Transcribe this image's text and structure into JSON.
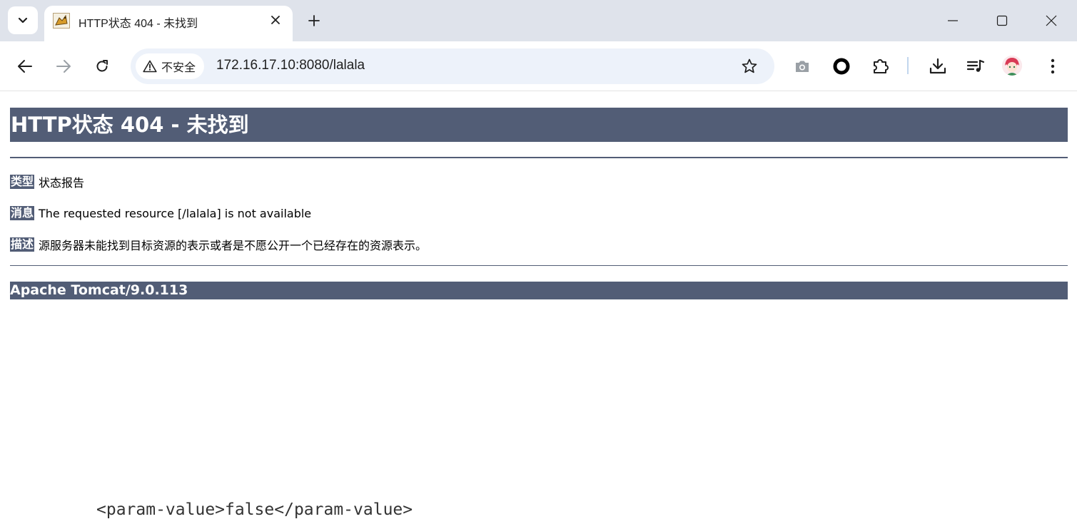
{
  "browser": {
    "tab": {
      "title": "HTTP状态 404 - 未找到"
    },
    "address_bar": {
      "security_label": "不安全",
      "url": "172.16.17.10:8080/lalala"
    }
  },
  "page": {
    "title": "HTTP状态 404 - 未找到",
    "type_label": "类型",
    "type_value": "状态报告",
    "message_label": "消息",
    "message_value": "The requested resource [/lalala] is not available",
    "description_label": "描述",
    "description_value": "源服务器未能找到目标资源的表示或者是不愿公开一个已经存在的资源表示。",
    "server_footer": "Apache Tomcat/9.0.113"
  },
  "background_text": "<param-value>false</param-value>",
  "colors": {
    "tomcat_header_bg": "#525d76",
    "tabstrip_bg": "#dfe3eb",
    "omnibox_bg": "#edf2fa"
  },
  "icons": {
    "tab_search": "chevron-down-icon",
    "favicon": "tomcat-favicon",
    "tab_close": "close-icon",
    "new_tab": "plus-icon",
    "minimize": "minimize-icon",
    "maximize": "maximize-icon",
    "close_window": "close-icon",
    "back": "arrow-left-icon",
    "forward": "arrow-right-icon",
    "reload": "reload-icon",
    "warning": "warning-triangle-icon",
    "bookmark": "star-icon",
    "screenshot": "camera-icon",
    "record": "circle-icon",
    "extensions": "puzzle-icon",
    "downloads": "download-icon",
    "media": "playlist-icon",
    "profile": "avatar",
    "menu": "kebab-menu-icon"
  }
}
